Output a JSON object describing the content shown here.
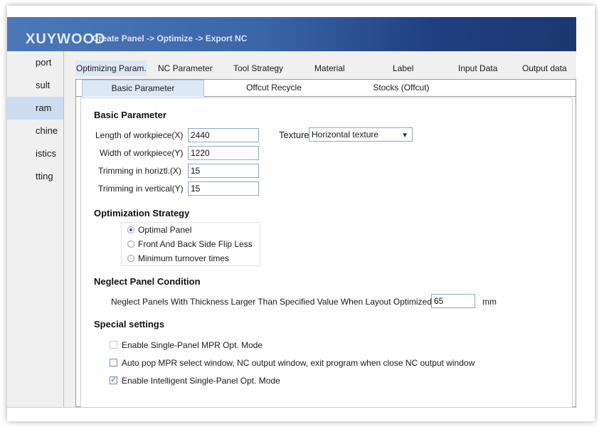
{
  "banner": {
    "logo": "XUYWOOD",
    "workflow": "Create Panel -> Optimize -> Export NC",
    "gradient_start": "#4d78b8",
    "gradient_end": "#1b3870"
  },
  "sidebar": {
    "items": [
      {
        "label": "port",
        "active": false
      },
      {
        "label": "sult",
        "active": false
      },
      {
        "label": "ram",
        "active": true
      },
      {
        "label": "chine",
        "active": false
      },
      {
        "label": "istics",
        "active": false
      },
      {
        "label": "tting",
        "active": false
      }
    ]
  },
  "top_tabs": [
    {
      "label": "Optimizing Param.",
      "active": true
    },
    {
      "label": "NC Parameter",
      "active": false
    },
    {
      "label": "Tool Strategy",
      "active": false
    },
    {
      "label": "Material",
      "active": false
    },
    {
      "label": "Label",
      "active": false
    },
    {
      "label": "Input Data",
      "active": false
    },
    {
      "label": "Output data",
      "active": false
    }
  ],
  "sub_tabs": [
    {
      "label": "Basic Parameter",
      "active": true
    },
    {
      "label": "Offcut Recycle",
      "active": false
    },
    {
      "label": "Stocks (Offcut)",
      "active": false
    }
  ],
  "basic": {
    "title": "Basic Parameter",
    "length_label": "Length of workpiece(X)",
    "length_value": "2440",
    "width_label": "Width of workpiece(Y)",
    "width_value": "1220",
    "trim_h_label": "Trimming in horiztl.(X)",
    "trim_h_value": "15",
    "trim_v_label": "Trimming in vertical(Y)",
    "trim_v_value": "15",
    "texture_label": "Texture",
    "texture_value": "Horizontal texture"
  },
  "strategy": {
    "title": "Optimization Strategy",
    "options": [
      {
        "label": "Optimal Panel",
        "checked": true
      },
      {
        "label": "Front And Back Side Flip Less",
        "checked": false
      },
      {
        "label": "Minimum turnover times",
        "checked": false
      }
    ]
  },
  "neglect": {
    "title": "Neglect Panel Condition",
    "label": "Neglect Panels With Thickness Larger Than Specified Value When Layout Optimized",
    "value": "65",
    "unit": "mm"
  },
  "special": {
    "title": "Special settings",
    "options": [
      {
        "label": "Enable Single-Panel MPR Opt. Mode",
        "checked": false,
        "disabled": true
      },
      {
        "label": "Auto pop MPR select window, NC output window, exit program when close NC output window",
        "checked": false,
        "disabled": false
      },
      {
        "label": "Enable Intelligent Single-Panel Opt. Mode",
        "checked": true,
        "disabled": false
      }
    ]
  }
}
